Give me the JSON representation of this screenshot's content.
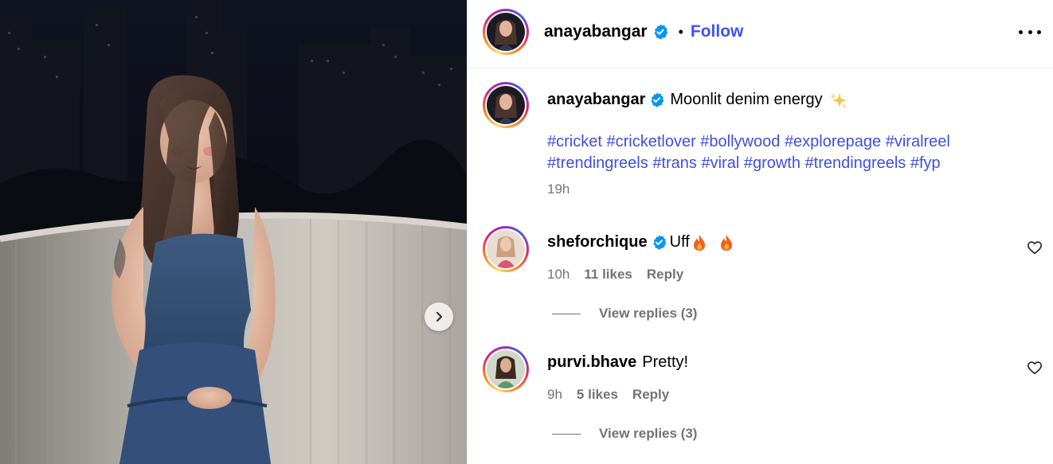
{
  "post": {
    "author": "anayabangar",
    "follow_label": "Follow",
    "separator": "•",
    "caption": "Moonlit denim energy",
    "caption_emoji": "sparkles",
    "hashtags_line1": [
      "#cricket",
      "#cricketlover",
      "#bollywood",
      "#explorepage",
      "#viralreel"
    ],
    "hashtags_line2": [
      "#trendingreels",
      "#trans",
      "#viral",
      "#growth",
      "#trendingreels",
      "#fyp"
    ],
    "time": "19h"
  },
  "comments": [
    {
      "user": "shefor‌chique",
      "verified": true,
      "text": "Uff",
      "emoji": [
        "fire",
        "fire"
      ],
      "time": "10h",
      "likes": "11 likes",
      "reply": "Reply",
      "view_replies": "View replies (3)"
    },
    {
      "user": "purvi.bhave",
      "verified": false,
      "text": "Pretty!",
      "time": "9h",
      "likes": "5 likes",
      "reply": "Reply",
      "view_replies": "View replies (3)"
    }
  ],
  "colors": {
    "link_blue": "#4150f7",
    "hashtag_blue": "#3f4fe0",
    "verified_blue": "#0095f6",
    "muted": "#737373"
  },
  "icons": [
    "chevron-right-icon",
    "verified-badge-icon",
    "more-options-icon",
    "heart-icon",
    "sparkles-icon",
    "fire-icon"
  ]
}
